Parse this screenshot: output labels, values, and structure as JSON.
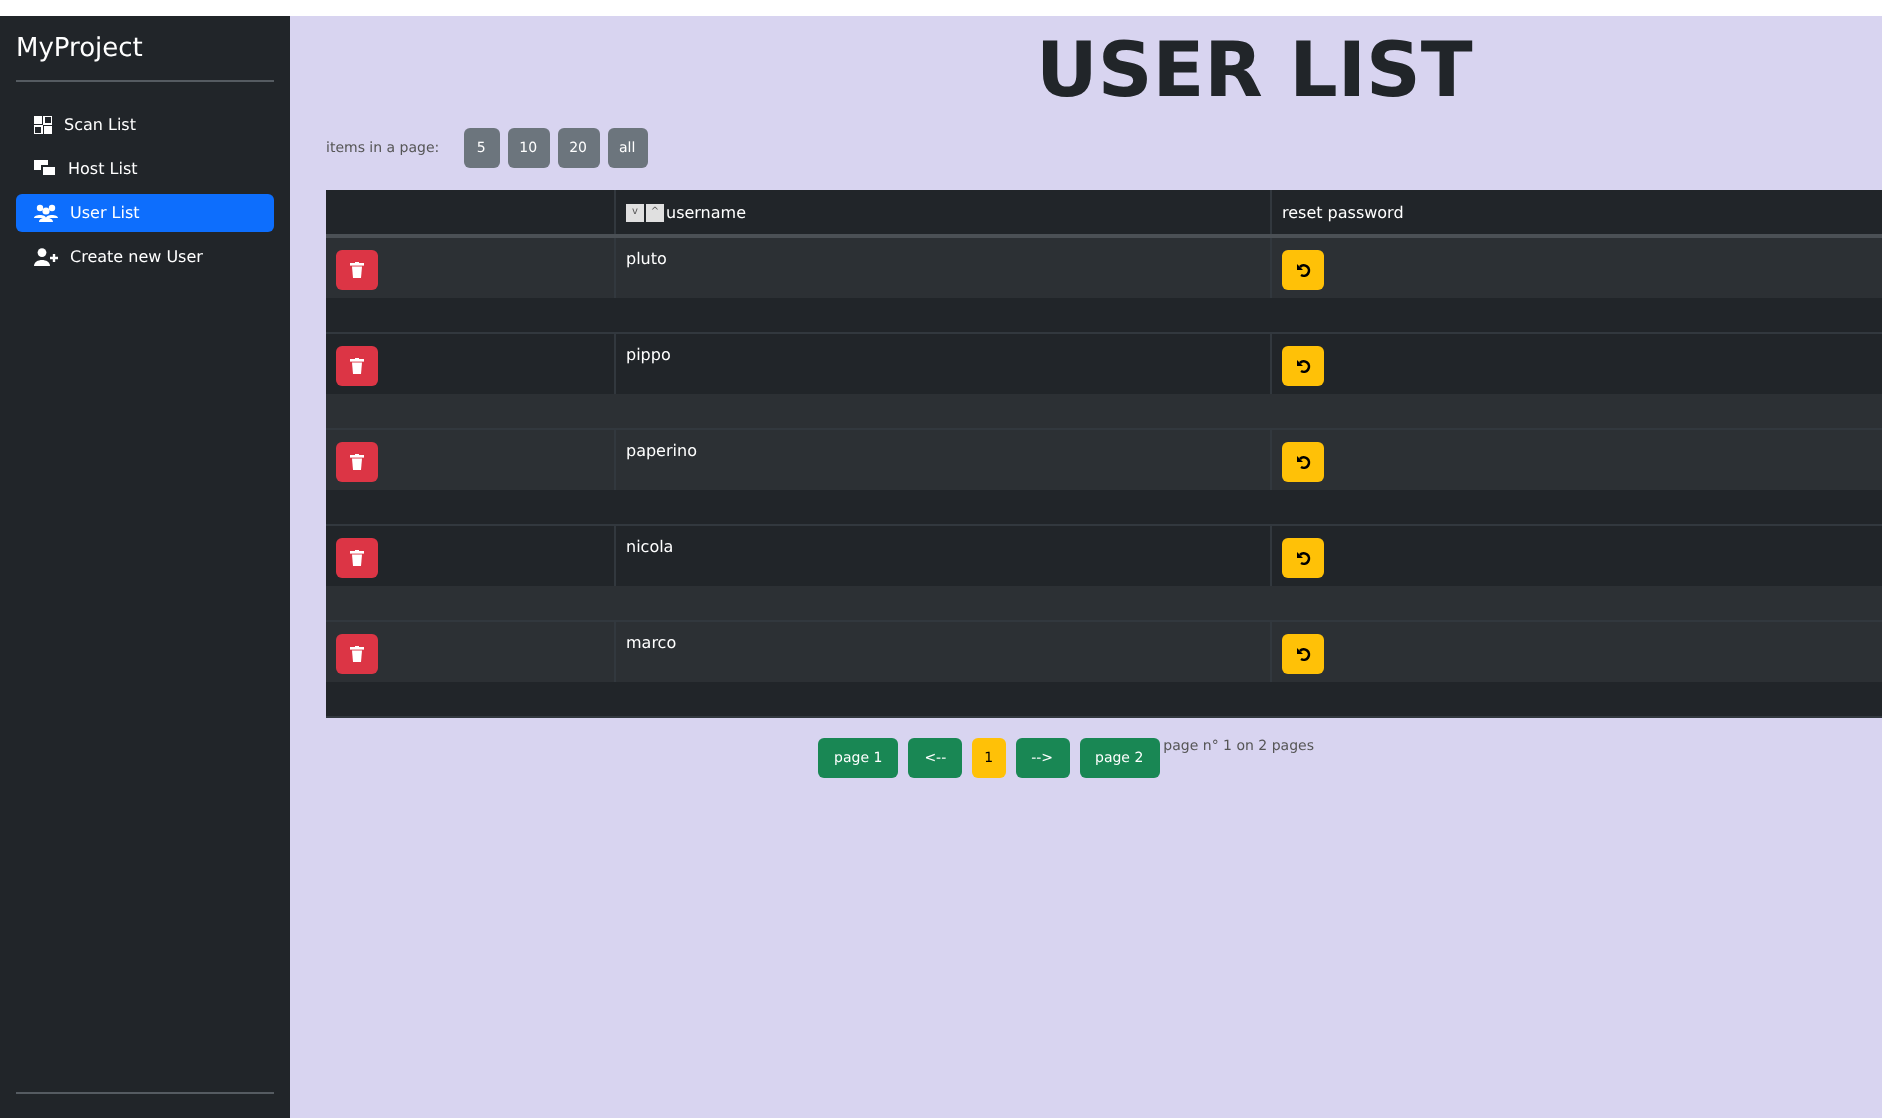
{
  "sidebar": {
    "brand": "MyProject",
    "items": [
      {
        "label": "Scan List",
        "selected": false
      },
      {
        "label": "Host List",
        "selected": false
      },
      {
        "label": "User List",
        "selected": true
      },
      {
        "label": "Create new User",
        "selected": false
      }
    ]
  },
  "title": "USER LIST",
  "page_size": {
    "label": "items in a page:",
    "options": [
      "5",
      "10",
      "20",
      "all"
    ]
  },
  "table": {
    "columns": [
      {},
      {
        "label": "username",
        "sort_buttons": [
          "v",
          "^"
        ]
      },
      {
        "label": "reset password"
      }
    ],
    "rows": [
      {
        "username": "pluto"
      },
      {
        "username": "pippo"
      },
      {
        "username": "paperino"
      },
      {
        "username": "nicola"
      },
      {
        "username": "marco"
      }
    ]
  },
  "pagination": {
    "buttons": [
      {
        "label": "page 1",
        "selected": false
      },
      {
        "label": "<--",
        "selected": false
      },
      {
        "label": "1",
        "selected": true
      },
      {
        "label": "-->",
        "selected": false
      },
      {
        "label": "page 2",
        "selected": false
      }
    ],
    "info": "page n° 1 on 2 pages"
  }
}
